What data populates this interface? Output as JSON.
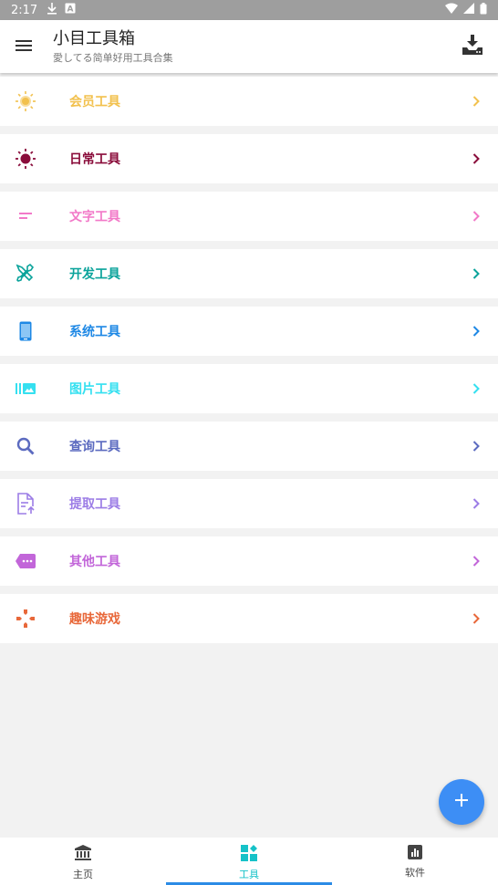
{
  "status_bar": {
    "time": "2:17"
  },
  "app_bar": {
    "title": "小目工具箱",
    "subtitle": "愛してる简单好用工具合集",
    "menu_icon": "menu-icon",
    "download_icon": "download-icon"
  },
  "tool_list": [
    {
      "label": "会员工具",
      "color": "#f2c14e",
      "icon": "sun-outline-icon"
    },
    {
      "label": "日常工具",
      "color": "#8a0d3b",
      "icon": "sun-filled-icon"
    },
    {
      "label": "文字工具",
      "color": "#f279c8",
      "icon": "short-text-icon"
    },
    {
      "label": "开发工具",
      "color": "#0aa39b",
      "icon": "tools-icon"
    },
    {
      "label": "系统工具",
      "color": "#1e88e5",
      "icon": "smartphone-icon"
    },
    {
      "label": "图片工具",
      "color": "#35e0f0",
      "icon": "photo-library-icon"
    },
    {
      "label": "查询工具",
      "color": "#5c6bc0",
      "icon": "search-icon"
    },
    {
      "label": "提取工具",
      "color": "#9c7de6",
      "icon": "file-upload-icon"
    },
    {
      "label": "其他工具",
      "color": "#c266d9",
      "icon": "label-more-icon"
    },
    {
      "label": "趣味游戏",
      "color": "#e8683a",
      "icon": "gamepad-icon"
    }
  ],
  "fab": {
    "icon": "plus-icon",
    "color": "#3d8ef5"
  },
  "bottom_nav": [
    {
      "label": "主页",
      "icon": "bank-icon",
      "active": false
    },
    {
      "label": "工具",
      "icon": "widgets-icon",
      "active": true
    },
    {
      "label": "软件",
      "icon": "chart-icon",
      "active": false
    }
  ]
}
